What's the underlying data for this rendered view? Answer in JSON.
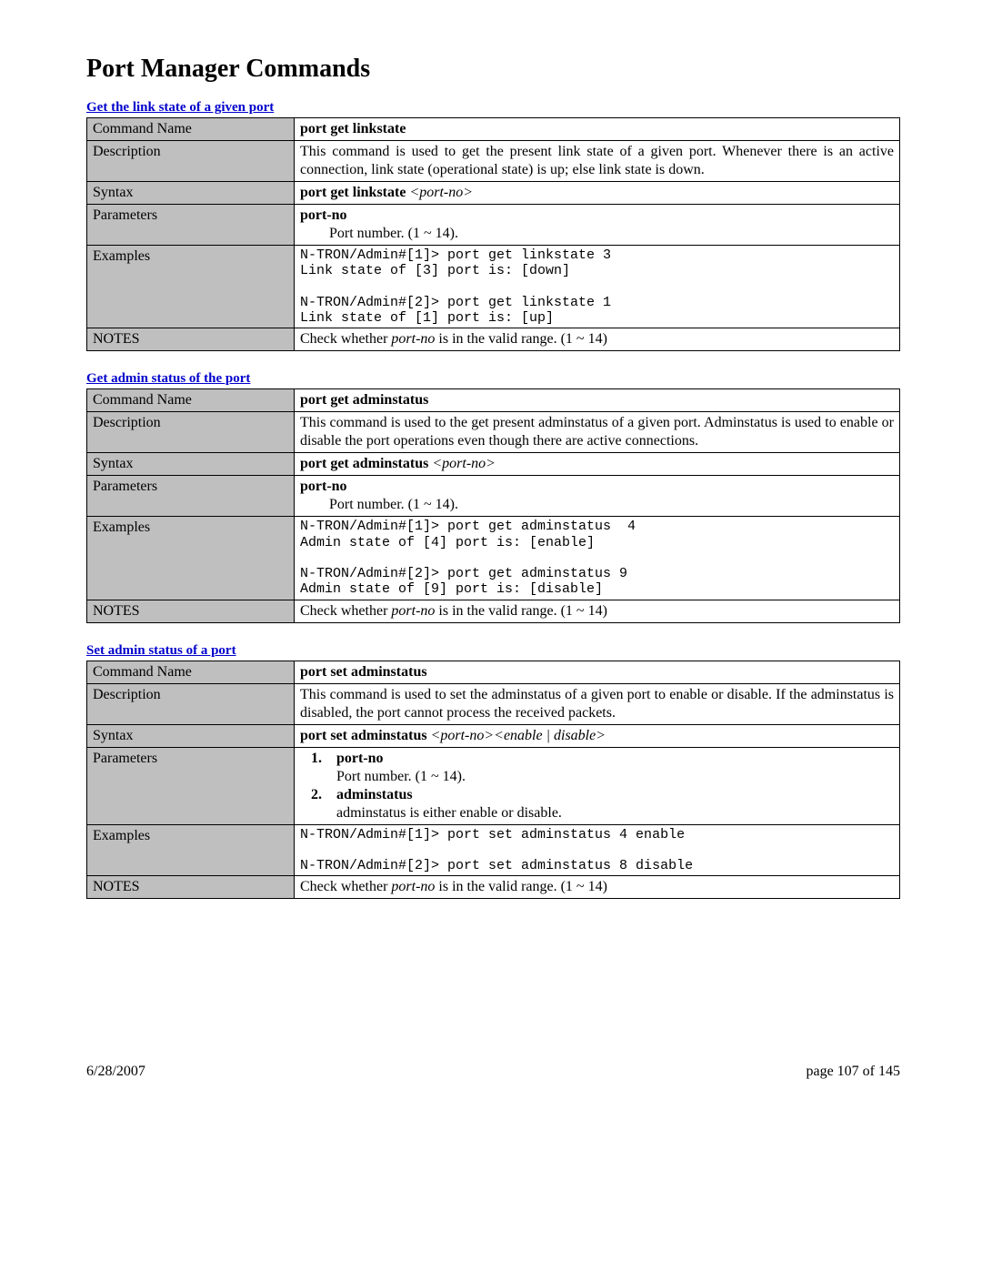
{
  "page_title": "Port Manager Commands",
  "footer": {
    "date": "6/28/2007",
    "page": "page 107 of 145"
  },
  "row_labels": {
    "cmd": "Command Name",
    "desc": "Description",
    "syntax": "Syntax",
    "params": "Parameters",
    "examples": "Examples",
    "notes": "NOTES"
  },
  "sec1": {
    "title": "Get the link state of a given port",
    "cmd": "port get linkstate",
    "desc": "This command is used to get the present link state of a given port. Whenever there is an active connection, link state (operational state) is up; else link state is down.",
    "syntax_cmd": "port get linkstate ",
    "syntax_arg": "<port-no>",
    "param_name": "port-no",
    "param_desc": "Port number. (1 ~ 14).",
    "examples": "N-TRON/Admin#[1]> port get linkstate 3\nLink state of [3] port is: [down]\n\nN-TRON/Admin#[2]> port get linkstate 1\nLink state of [1] port is: [up]",
    "notes_a": "Check whether ",
    "notes_i": "port-no",
    "notes_b": " is in the valid range. (1 ~ 14)"
  },
  "sec2": {
    "title": "Get admin status of the port",
    "cmd": "port get adminstatus",
    "desc": "This command is used to the get present adminstatus of a given port. Adminstatus is used to enable or disable the port operations even though there are active connections.",
    "syntax_cmd": "port get adminstatus ",
    "syntax_arg": "<port-no>",
    "param_name": "port-no",
    "param_desc": "Port number. (1 ~ 14).",
    "examples": "N-TRON/Admin#[1]> port get adminstatus  4\nAdmin state of [4] port is: [enable]\n\nN-TRON/Admin#[2]> port get adminstatus 9\nAdmin state of [9] port is: [disable]",
    "notes_a": "Check whether ",
    "notes_i": "port-no",
    "notes_b": " is in the valid range. (1 ~ 14)"
  },
  "sec3": {
    "title": "Set admin status of a port",
    "cmd": "port set adminstatus",
    "desc": "This command is used to set the adminstatus of a given port to enable or disable. If the adminstatus is disabled, the port cannot process the received packets.",
    "syntax_cmd": "port set adminstatus ",
    "syntax_arg": "<port-no><enable | disable>",
    "p1_num": "1.",
    "p1_name": "port-no",
    "p1_desc": "Port number. (1 ~ 14).",
    "p2_num": "2.",
    "p2_name": "adminstatus",
    "p2_desc": "adminstatus is either enable or disable.",
    "examples": "N-TRON/Admin#[1]> port set adminstatus 4 enable\n\nN-TRON/Admin#[2]> port set adminstatus 8 disable",
    "notes_a": "Check whether ",
    "notes_i": "port-no",
    "notes_b": " is in the valid range. (1 ~ 14)"
  }
}
